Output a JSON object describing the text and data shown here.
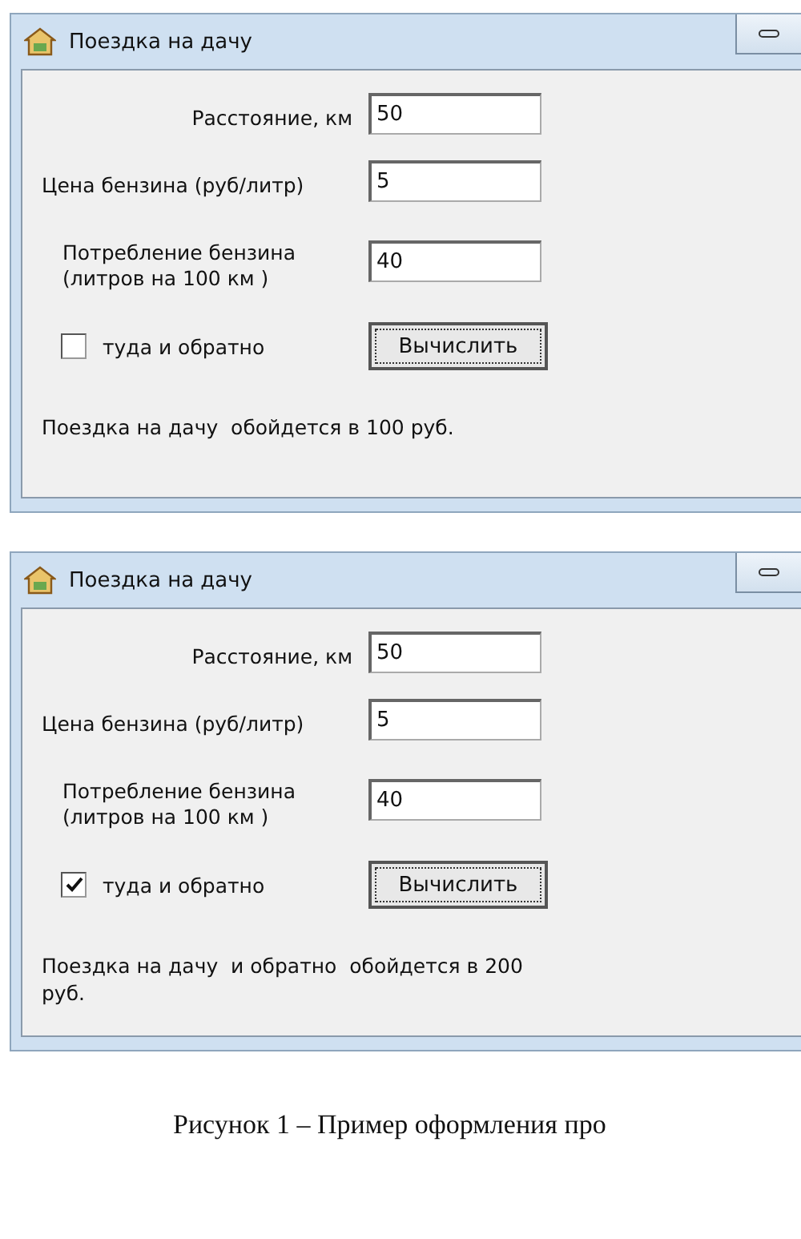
{
  "windows": [
    {
      "title": "Поездка на дачу",
      "fields": [
        {
          "label": "Расстояние, км",
          "value": "50"
        },
        {
          "label": "Цена бензина (руб/литр)",
          "value": "5"
        },
        {
          "label": "Потребление бензина\n(литров на 100 км )",
          "value": "40"
        }
      ],
      "checkbox": {
        "label": "туда и обратно",
        "checked": false
      },
      "button": "Вычислить",
      "result": "Поездка на дачу  обойдется в 100 руб."
    },
    {
      "title": "Поездка на дачу",
      "fields": [
        {
          "label": "Расстояние, км",
          "value": "50"
        },
        {
          "label": "Цена бензина (руб/литр)",
          "value": "5"
        },
        {
          "label": "Потребление бензина\n(литров на 100 км )",
          "value": "40"
        }
      ],
      "checkbox": {
        "label": "туда и обратно",
        "checked": true
      },
      "button": "Вычислить",
      "result": "Поездка на дачу  и обратно  обойдется в 200 руб."
    }
  ],
  "caption": "Рисунок 1 – Пример оформления про"
}
